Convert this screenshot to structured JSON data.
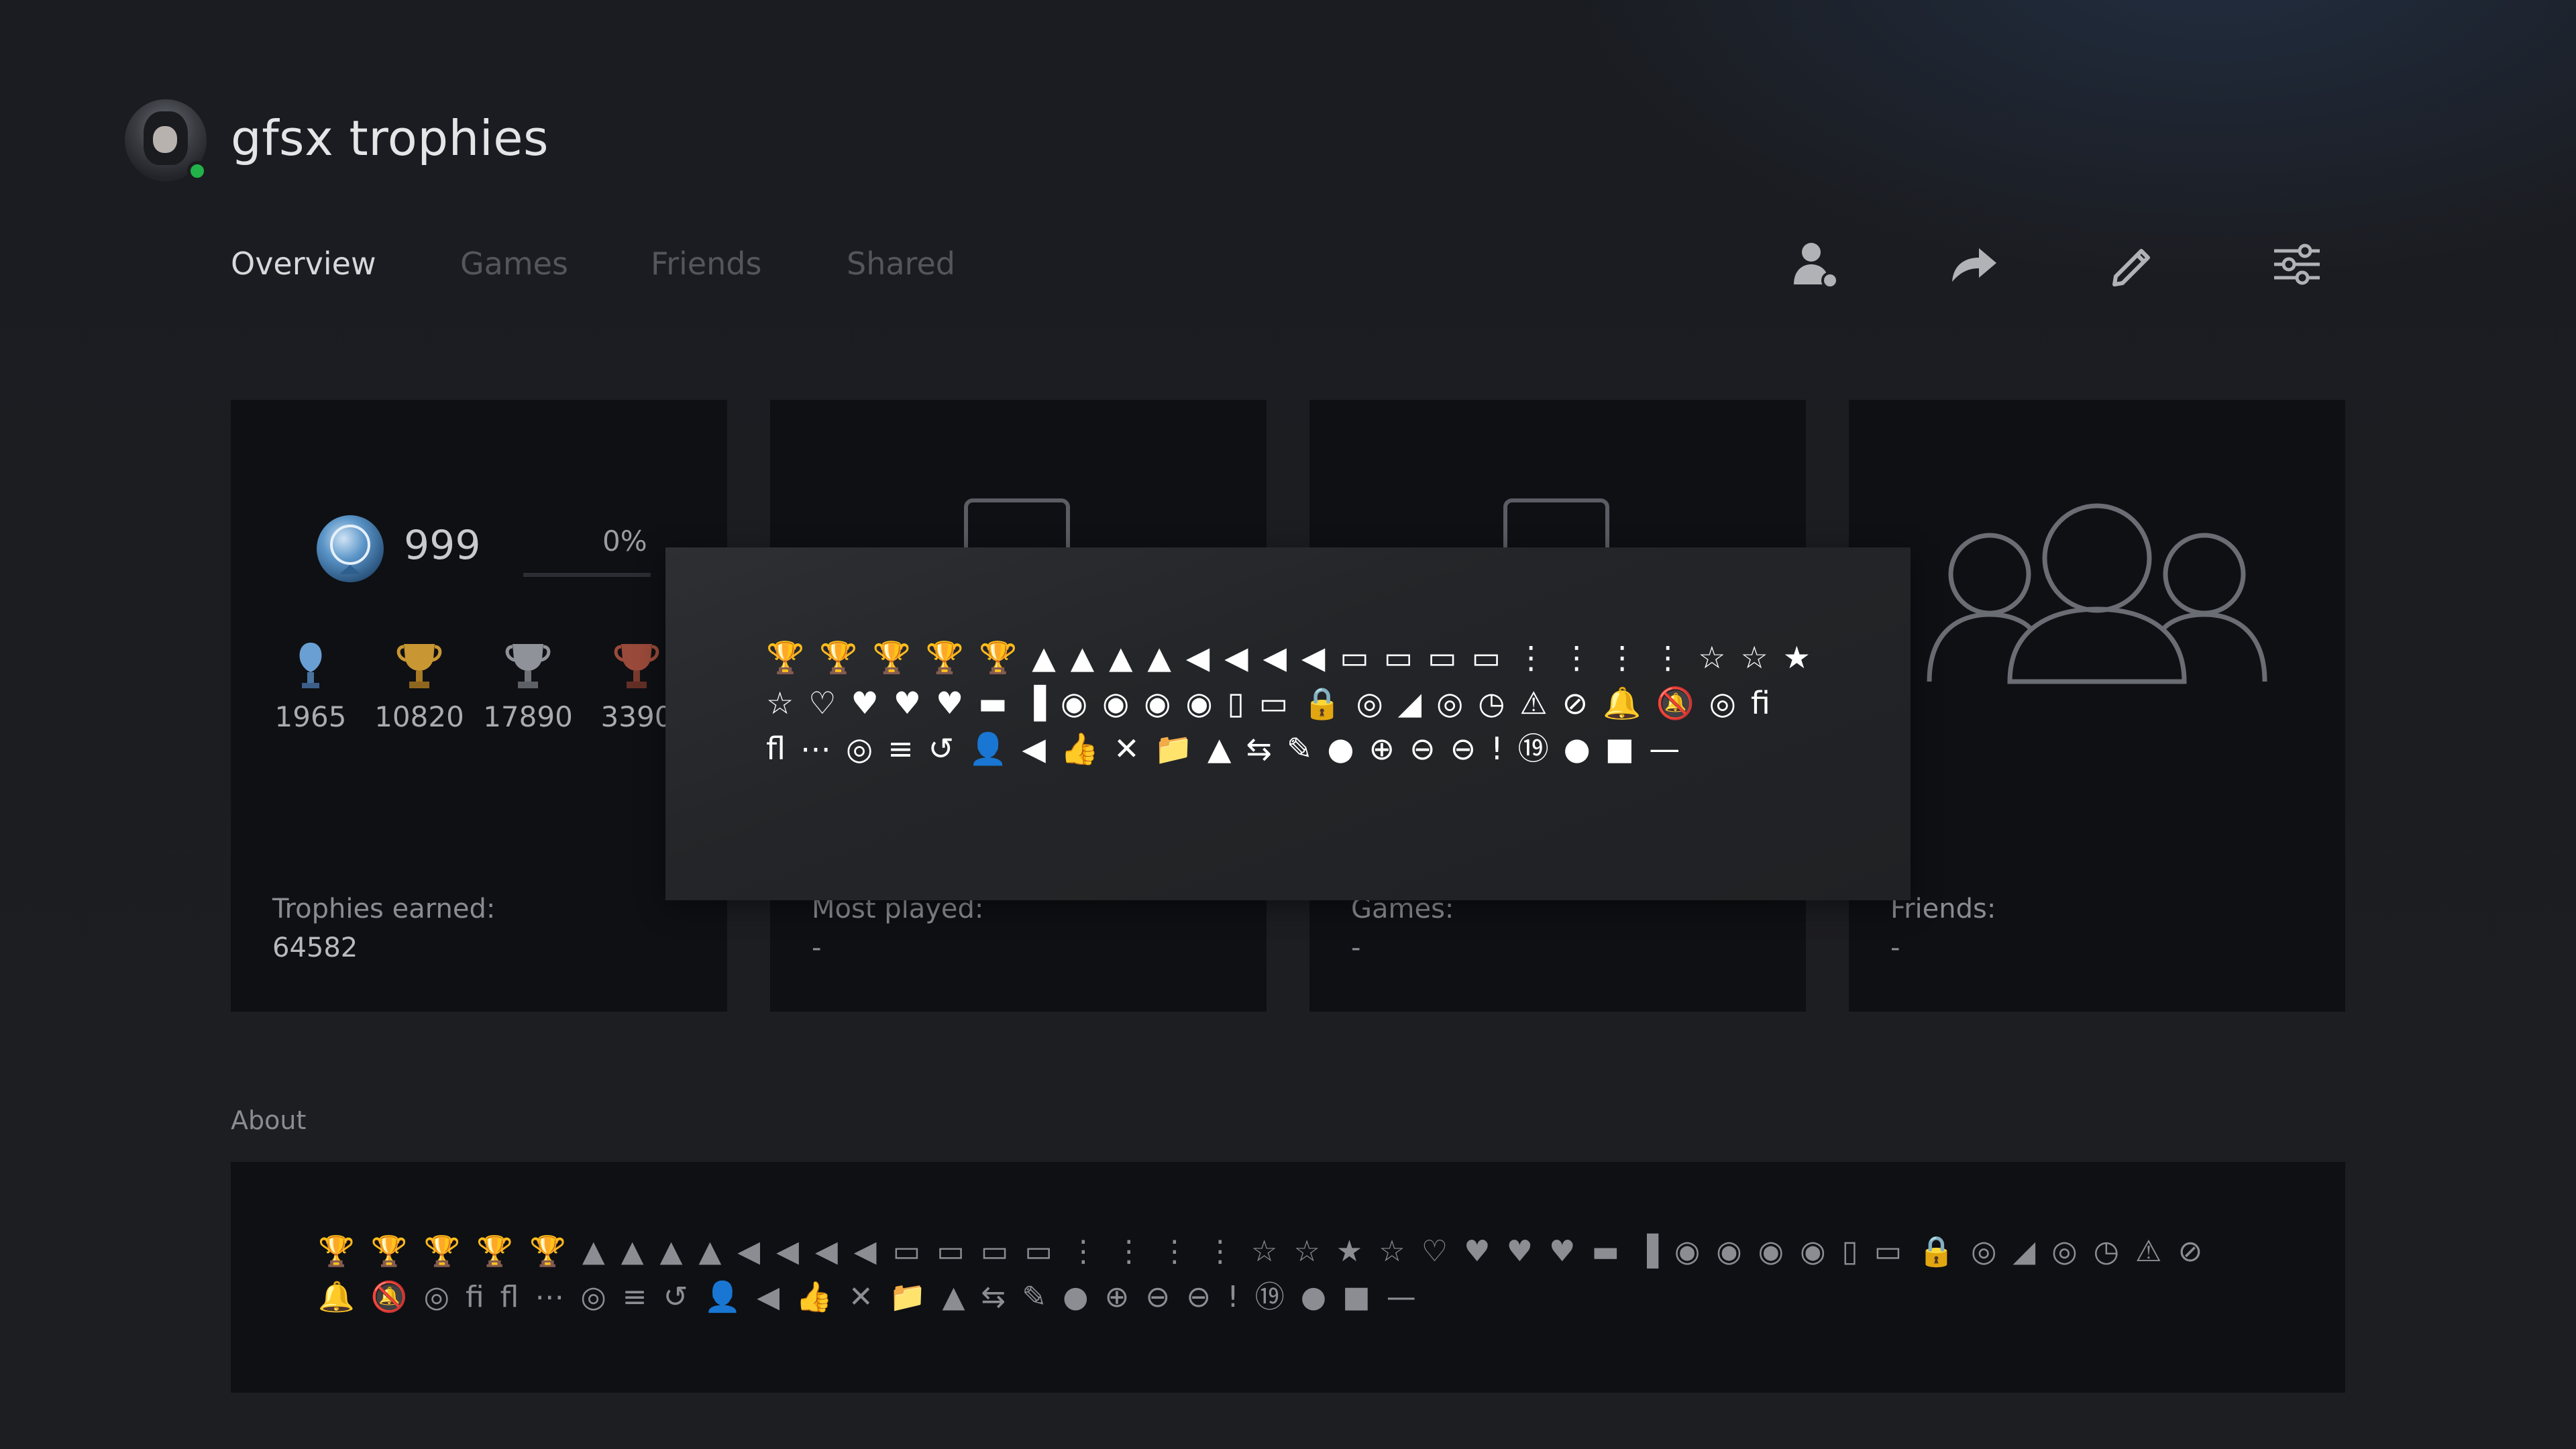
{
  "profile": {
    "name": "gfsx trophies",
    "status_color": "#21b24a"
  },
  "tabs": [
    {
      "label": "Overview",
      "active": true
    },
    {
      "label": "Games",
      "active": false
    },
    {
      "label": "Friends",
      "active": false
    },
    {
      "label": "Shared",
      "active": false
    }
  ],
  "header_icons": [
    "friend-request-icon",
    "share-icon",
    "edit-icon",
    "settings-icon"
  ],
  "cards": {
    "trophies": {
      "level": "999",
      "progress_percent": "0%",
      "progress_fraction": 0.0,
      "counts": {
        "platinum": "1965",
        "gold": "10820",
        "silver": "17890",
        "bronze": "3390"
      },
      "label": "Trophies earned:",
      "value": "64582"
    },
    "most_played": {
      "label": "Most played:",
      "value": "-"
    },
    "games": {
      "label": "Games:",
      "value": "-"
    },
    "friends": {
      "label": "Friends:",
      "value": "-"
    }
  },
  "overlay": {
    "glyphs": "🏆🏆🏆🏆🏆▲▲▲▲◀◀◀◀▭▭▭▭⋮⋮⋮⋮☆☆★☆♡♥♥♥▬▐◉◉◉◉▯▭🔒◎◢◎◷⚠⊘🔔🔕◎ﬁﬂ⋯◎≡↺👤◀👍✕📁▲⇆✎●⊕⊖⊖!⑲●■—"
  },
  "about": {
    "label": "About",
    "glyphs": "🏆🏆🏆🏆🏆▲▲▲▲◀◀◀◀▭▭▭▭⋮⋮⋮⋮☆☆★☆♡♥♥♥▬▐◉◉◉◉▯▭🔒◎◢◎◷⚠⊘🔔🔕◎ﬁﬂ⋯◎≡↺👤◀👍✕📁▲⇆✎●⊕⊖⊖!⑲●■—"
  },
  "colors": {
    "platinum": "#5a8fd0",
    "gold": "#c89632",
    "silver": "#8f9399",
    "bronze": "#9a4a3a",
    "card_bg": "#0f1014"
  }
}
